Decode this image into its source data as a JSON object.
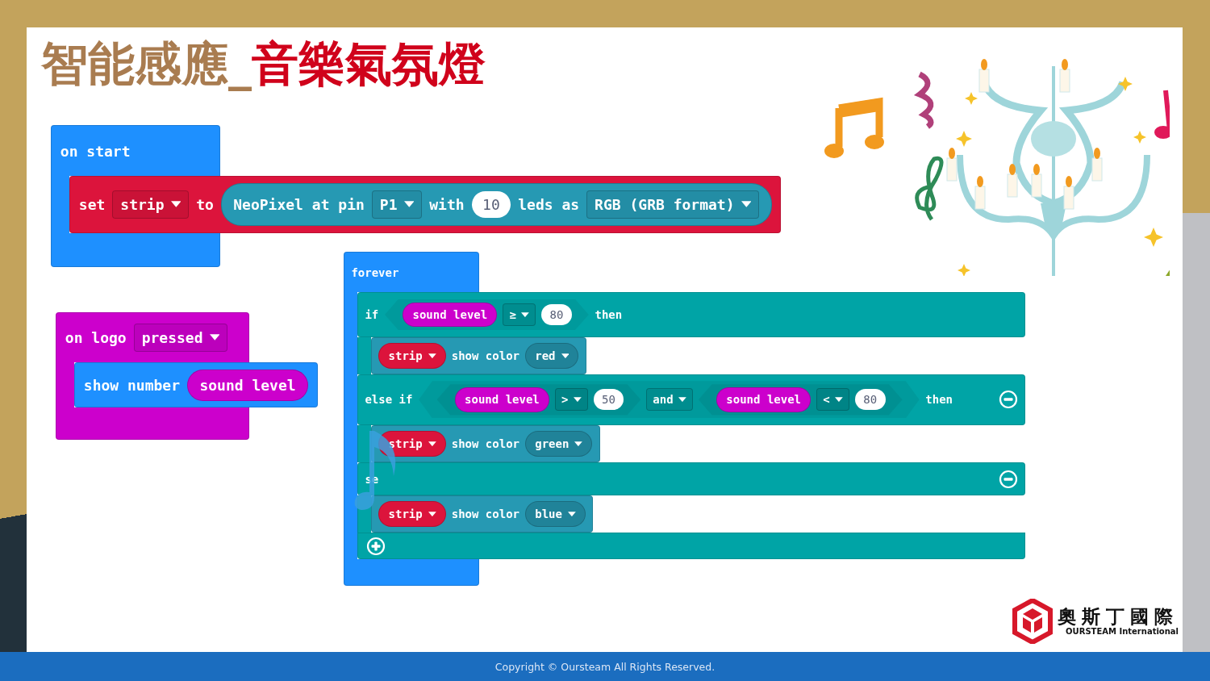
{
  "title": [
    {
      "text": "智能感應_",
      "color": "#a97c50"
    },
    {
      "text": "音樂氣氛燈",
      "color": "#d0021b"
    }
  ],
  "scripts": [
    {
      "kind": "event",
      "color": "#1e90ff",
      "header": [
        {
          "kind": "text",
          "text": "on start"
        }
      ],
      "body": [
        {
          "kind": "statement",
          "color": "#dc143c",
          "tokens": [
            {
              "kind": "text",
              "text": "set"
            },
            {
              "kind": "dropdown",
              "text": "strip"
            },
            {
              "kind": "text",
              "text": "to"
            },
            {
              "kind": "reporter",
              "color": "#2699b3",
              "tokens": [
                {
                  "kind": "text",
                  "text": "NeoPixel at pin"
                },
                {
                  "kind": "dropdown",
                  "text": "P1"
                },
                {
                  "kind": "text",
                  "text": "with"
                },
                {
                  "kind": "number",
                  "text": "10"
                },
                {
                  "kind": "text",
                  "text": "leds as"
                },
                {
                  "kind": "dropdown",
                  "text": "RGB (GRB format)"
                }
              ]
            }
          ]
        }
      ]
    },
    {
      "kind": "event",
      "color": "#cc00cc",
      "header": [
        {
          "kind": "text",
          "text": "on logo"
        },
        {
          "kind": "dropdown",
          "text": "pressed"
        }
      ],
      "body": [
        {
          "kind": "statement",
          "color": "#1e90ff",
          "tokens": [
            {
              "kind": "text",
              "text": "show number"
            },
            {
              "kind": "reporter",
              "color": "#cc00cc",
              "text": "sound level"
            }
          ]
        }
      ]
    },
    {
      "kind": "event",
      "color": "#1e90ff",
      "header": [
        {
          "kind": "text",
          "text": "forever"
        }
      ],
      "body": [
        {
          "kind": "if",
          "color": "#00a4a6",
          "clauses": [
            {
              "tokens": [
                {
                  "kind": "text",
                  "text": "if"
                },
                {
                  "kind": "condition",
                  "tokens": [
                    {
                      "kind": "reporter",
                      "color": "#cc00cc",
                      "text": "sound level"
                    },
                    {
                      "kind": "dropdown",
                      "text": "≥"
                    },
                    {
                      "kind": "number",
                      "text": "80"
                    }
                  ]
                },
                {
                  "kind": "text",
                  "text": "then"
                }
              ],
              "body": [
                {
                  "kind": "statement",
                  "color": "#2699b3",
                  "tokens": [
                    {
                      "kind": "variable",
                      "color": "#dc143c",
                      "text": "strip"
                    },
                    {
                      "kind": "text",
                      "text": "show color"
                    },
                    {
                      "kind": "enum",
                      "text": "red"
                    }
                  ]
                }
              ]
            },
            {
              "tokens": [
                {
                  "kind": "text",
                  "text": "else if"
                },
                {
                  "kind": "condition",
                  "tokens": [
                    {
                      "kind": "condition",
                      "tokens": [
                        {
                          "kind": "reporter",
                          "color": "#cc00cc",
                          "text": "sound level"
                        },
                        {
                          "kind": "dropdown",
                          "text": ">"
                        },
                        {
                          "kind": "number",
                          "text": "50"
                        }
                      ]
                    },
                    {
                      "kind": "dropdown",
                      "text": "and"
                    },
                    {
                      "kind": "condition",
                      "tokens": [
                        {
                          "kind": "reporter",
                          "color": "#cc00cc",
                          "text": "sound level"
                        },
                        {
                          "kind": "dropdown",
                          "text": "<"
                        },
                        {
                          "kind": "number",
                          "text": "80"
                        }
                      ]
                    }
                  ]
                },
                {
                  "kind": "text",
                  "text": "then"
                },
                {
                  "kind": "remove"
                }
              ],
              "body": [
                {
                  "kind": "statement",
                  "color": "#2699b3",
                  "tokens": [
                    {
                      "kind": "variable",
                      "color": "#dc143c",
                      "text": "strip"
                    },
                    {
                      "kind": "text",
                      "text": "show color"
                    },
                    {
                      "kind": "enum",
                      "text": "green"
                    }
                  ]
                }
              ]
            },
            {
              "tokens": [
                {
                  "kind": "text",
                  "text": "se"
                },
                {
                  "kind": "remove"
                }
              ],
              "body": [
                {
                  "kind": "statement",
                  "color": "#2699b3",
                  "tokens": [
                    {
                      "kind": "variable",
                      "color": "#dc143c",
                      "text": "strip"
                    },
                    {
                      "kind": "text",
                      "text": "show color"
                    },
                    {
                      "kind": "enum",
                      "text": "blue"
                    }
                  ]
                }
              ]
            }
          ],
          "footer": [
            {
              "kind": "add"
            }
          ]
        }
      ]
    }
  ],
  "logo": {
    "name": "奧斯丁國際",
    "tagline": "OURSTEAM International"
  },
  "footer": "Copyright © Oursteam All Rights Reserved."
}
